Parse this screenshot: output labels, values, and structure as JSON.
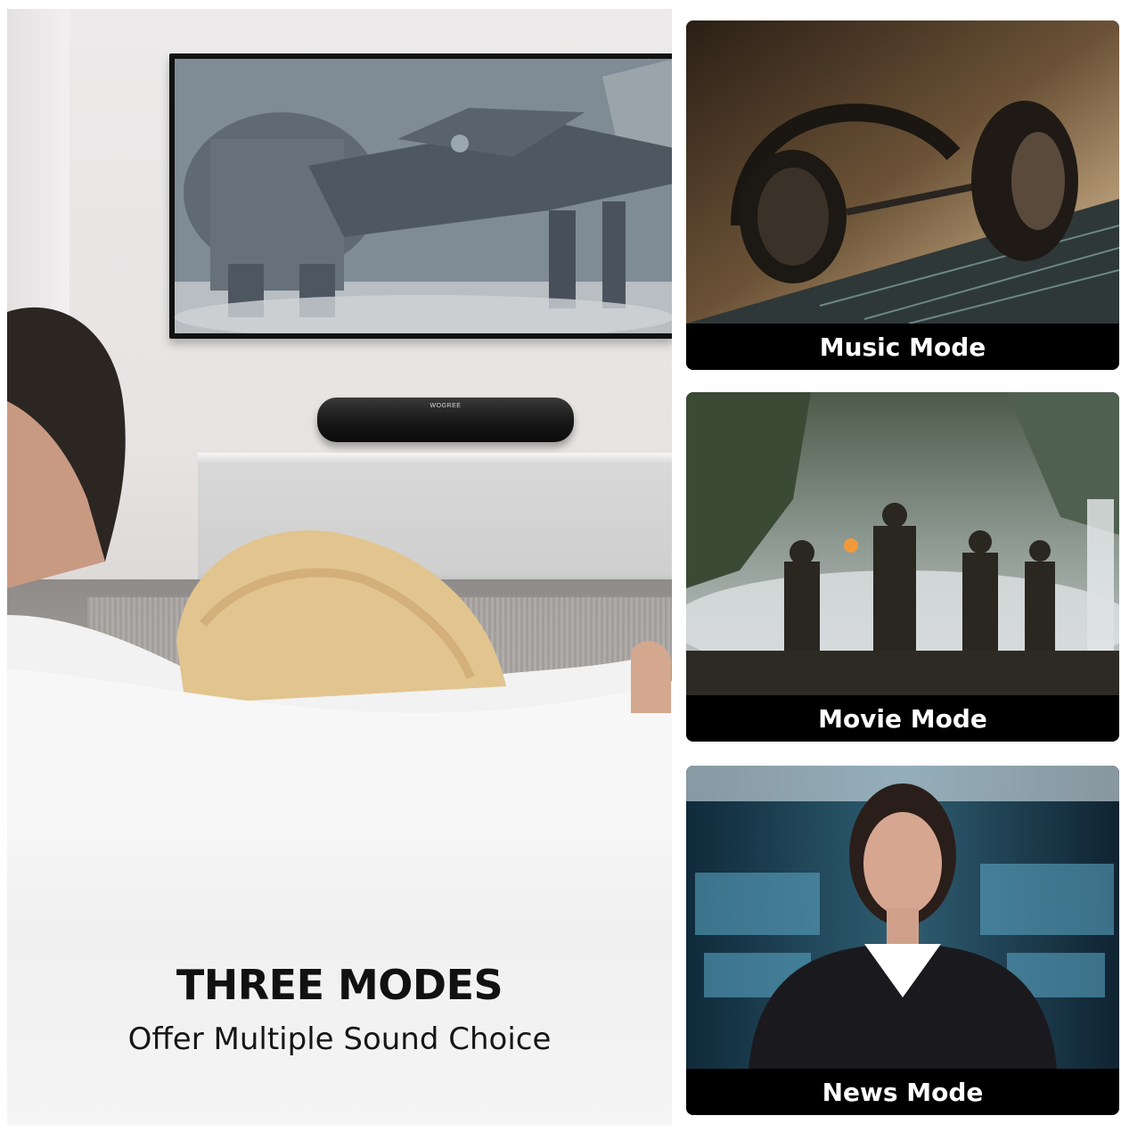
{
  "hero": {
    "soundbar_brand": "WOGREE",
    "headline": "THREE MODES",
    "subheadline": "Offer Multiple Sound Choice"
  },
  "modes": [
    {
      "label": "Music Mode",
      "scene_icon": "headphones-icon"
    },
    {
      "label": "Movie Mode",
      "scene_icon": "jungle-explorers-scene"
    },
    {
      "label": "News Mode",
      "scene_icon": "news-anchor-scene"
    }
  ],
  "colors": {
    "label_bar": "#000000",
    "label_text": "#ffffff",
    "headline_text": "#111111"
  }
}
